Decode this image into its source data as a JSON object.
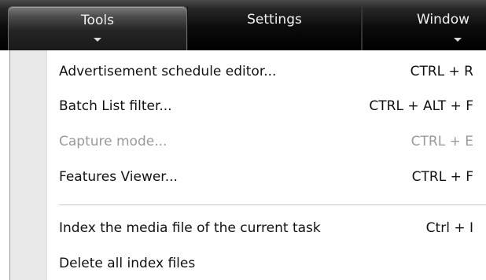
{
  "menubar": {
    "tabs": [
      {
        "label": "Tools",
        "active": true
      },
      {
        "label": "Settings",
        "active": false
      },
      {
        "label": "Window",
        "active": false
      }
    ]
  },
  "dropdown": {
    "items": [
      {
        "label": "Advertisement schedule editor...",
        "shortcut": "CTRL + R",
        "enabled": true
      },
      {
        "label": "Batch List filter...",
        "shortcut": "CTRL + ALT + F",
        "enabled": true
      },
      {
        "label": "Capture mode...",
        "shortcut": "CTRL + E",
        "enabled": false
      },
      {
        "label": "Features Viewer...",
        "shortcut": "CTRL + F",
        "enabled": true
      },
      {
        "label": "Index the media file of the current task",
        "shortcut": "Ctrl + I",
        "enabled": true
      },
      {
        "label": "Delete all index files",
        "shortcut": "",
        "enabled": true
      }
    ]
  },
  "colors": {
    "menubar_bg": "#000000",
    "tab_text": "#f2f2f2",
    "item_text": "#111111",
    "disabled_text": "#9a9a9a",
    "gutter": "#e9e9e9"
  }
}
